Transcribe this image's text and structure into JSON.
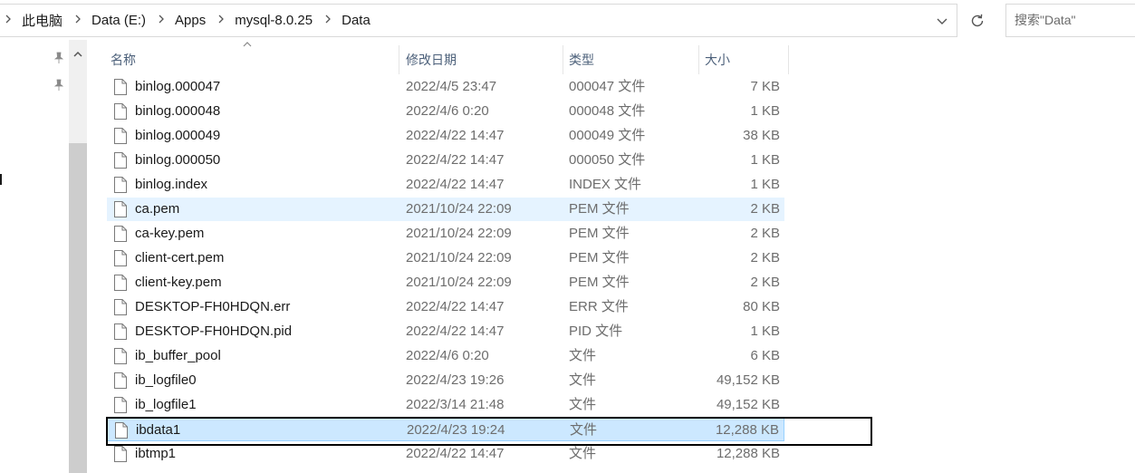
{
  "breadcrumb": {
    "items": [
      "此电脑",
      "Data (E:)",
      "Apps",
      "mysql-8.0.25",
      "Data"
    ]
  },
  "search": {
    "placeholder": "搜索\"Data\""
  },
  "icons": {
    "refresh": "refresh-icon",
    "dropdown": "chevron-down-icon",
    "pin": "pin-icon",
    "file": "file-icon"
  },
  "columns": {
    "name": "名称",
    "date": "修改日期",
    "type": "类型",
    "size": "大小"
  },
  "files": [
    {
      "name": "binlog.000047",
      "date": "2022/4/5 23:47",
      "type": "000047 文件",
      "size": "7 KB"
    },
    {
      "name": "binlog.000048",
      "date": "2022/4/6 0:20",
      "type": "000048 文件",
      "size": "1 KB"
    },
    {
      "name": "binlog.000049",
      "date": "2022/4/22 14:47",
      "type": "000049 文件",
      "size": "38 KB"
    },
    {
      "name": "binlog.000050",
      "date": "2022/4/22 14:47",
      "type": "000050 文件",
      "size": "1 KB"
    },
    {
      "name": "binlog.index",
      "date": "2022/4/22 14:47",
      "type": "INDEX 文件",
      "size": "1 KB"
    },
    {
      "name": "ca.pem",
      "date": "2021/10/24 22:09",
      "type": "PEM 文件",
      "size": "2 KB",
      "state": "hover"
    },
    {
      "name": "ca-key.pem",
      "date": "2021/10/24 22:09",
      "type": "PEM 文件",
      "size": "2 KB"
    },
    {
      "name": "client-cert.pem",
      "date": "2021/10/24 22:09",
      "type": "PEM 文件",
      "size": "2 KB"
    },
    {
      "name": "client-key.pem",
      "date": "2021/10/24 22:09",
      "type": "PEM 文件",
      "size": "2 KB"
    },
    {
      "name": "DESKTOP-FH0HDQN.err",
      "date": "2022/4/22 14:47",
      "type": "ERR 文件",
      "size": "80 KB"
    },
    {
      "name": "DESKTOP-FH0HDQN.pid",
      "date": "2022/4/22 14:47",
      "type": "PID 文件",
      "size": "1 KB"
    },
    {
      "name": "ib_buffer_pool",
      "date": "2022/4/6 0:20",
      "type": "文件",
      "size": "6 KB"
    },
    {
      "name": "ib_logfile0",
      "date": "2022/4/23 19:26",
      "type": "文件",
      "size": "49,152 KB"
    },
    {
      "name": "ib_logfile1",
      "date": "2022/3/14 21:48",
      "type": "文件",
      "size": "49,152 KB"
    },
    {
      "name": "ibdata1",
      "date": "2022/4/23 19:24",
      "type": "文件",
      "size": "12,288 KB",
      "state": "selected"
    },
    {
      "name": "ibtmp1",
      "date": "2022/4/22 14:47",
      "type": "文件",
      "size": "12,288 KB"
    }
  ],
  "colors": {
    "hover": "#e5f3ff",
    "selected": "#cce8ff",
    "header_text": "#4c607a",
    "annotation_box": "#000000"
  }
}
